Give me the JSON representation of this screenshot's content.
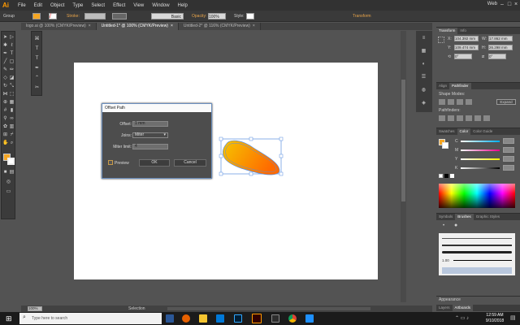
{
  "app": {
    "logo": "Ai",
    "workspace": "Web"
  },
  "menu": [
    "File",
    "Edit",
    "Object",
    "Type",
    "Select",
    "Effect",
    "View",
    "Window",
    "Help"
  ],
  "control": {
    "selection_label": "Group",
    "stroke_label": "Stroke:",
    "brush_label": "Basic",
    "opacity_label": "Opacity:",
    "opacity_value": "100%",
    "style_label": "Style:",
    "transform_label": "Transform"
  },
  "tabs": [
    {
      "label": "logo.ai @ 100% (CMYK/Preview)",
      "active": false
    },
    {
      "label": "Untitled-1* @ 100% (CMYK/Preview)",
      "active": true
    },
    {
      "label": "Untitled-2* @ 116% (CMYK/Preview)",
      "active": false
    }
  ],
  "dialog": {
    "title": "Offset Path",
    "offset_label": "Offset:",
    "offset_value": "1 mm",
    "joins_label": "Joins:",
    "joins_value": "Miter",
    "miter_label": "Miter limit:",
    "miter_value": "4",
    "preview_label": "Preview",
    "ok_label": "OK",
    "cancel_label": "Cancel"
  },
  "panels": {
    "transform": {
      "tabs": [
        "Transform",
        "Info"
      ],
      "x_label": "X:",
      "x_value": "104.392 mm",
      "y_label": "Y:",
      "y_value": "109.474 mm",
      "w_label": "W:",
      "w_value": "17.862 mm",
      "h_label": "H:",
      "h_value": "26.298 mm",
      "angle_value": "0°",
      "shear_value": "0°"
    },
    "align": {
      "tabs": [
        "Align",
        "Pathfinder"
      ],
      "shape_modes": "Shape Modes:",
      "expand": "Expand",
      "pathfinders": "Pathfinders:"
    },
    "swatches": {
      "tabs": [
        "Swatches",
        "Color",
        "Color Guide"
      ],
      "channels": [
        "C",
        "M",
        "Y",
        "K"
      ]
    },
    "brushes": {
      "tabs": [
        "Symbols",
        "Brushes",
        "Graphic Styles"
      ],
      "size_label": "1.00"
    },
    "appearance": {
      "title": "Appearance"
    },
    "layers": {
      "tabs": [
        "Layers",
        "Artboards"
      ]
    }
  },
  "status": {
    "zoom": "100%",
    "tool": "Selection"
  },
  "taskbar": {
    "search_placeholder": "Type here to search",
    "time": "12:59 AM",
    "date": "9/10/2018"
  },
  "colors": {
    "gradient_start": "#f5c400",
    "gradient_end": "#ff6a00",
    "selection": "#5b8fe0"
  }
}
